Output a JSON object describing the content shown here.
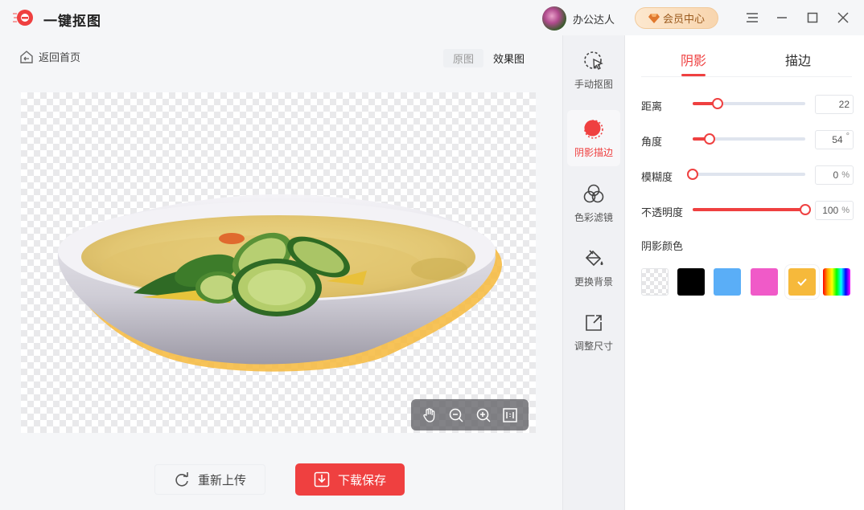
{
  "app": {
    "title": "一键抠图"
  },
  "user": {
    "name": "办公达人"
  },
  "vip": {
    "label": "会员中心"
  },
  "nav": {
    "back_label": "返回首页"
  },
  "view_toggle": {
    "original": "原图",
    "result": "效果图",
    "selected": "效果图"
  },
  "actions": {
    "reupload": "重新上传",
    "download": "下载保存"
  },
  "tools": [
    {
      "label": "手动抠图",
      "icon": "cursor-select-icon",
      "active": false
    },
    {
      "label": "阴影描边",
      "icon": "shadow-stroke-icon",
      "active": true
    },
    {
      "label": "色彩滤镜",
      "icon": "color-filter-icon",
      "active": false
    },
    {
      "label": "更换背景",
      "icon": "paint-bucket-icon",
      "active": false
    },
    {
      "label": "调整尺寸",
      "icon": "resize-icon",
      "active": false
    }
  ],
  "panel": {
    "tabs": [
      {
        "label": "阴影",
        "active": true
      },
      {
        "label": "描边",
        "active": false
      }
    ],
    "params": [
      {
        "label": "距离",
        "value": "22",
        "unit": "",
        "fraction": 0.22
      },
      {
        "label": "角度",
        "value": "54",
        "unit": "°",
        "fraction": 0.15
      },
      {
        "label": "模糊度",
        "value": "0",
        "unit": "%",
        "fraction": 0.0
      },
      {
        "label": "不透明度",
        "value": "100",
        "unit": "%",
        "fraction": 1.0
      }
    ],
    "color_label": "阴影颜色",
    "colors": [
      "transparent",
      "#000000",
      "#5aaef7",
      "#f05ac8",
      "#f6b93b",
      "rainbow"
    ],
    "selected_color": "#f6b93b"
  },
  "accent_color": "#ef4040"
}
